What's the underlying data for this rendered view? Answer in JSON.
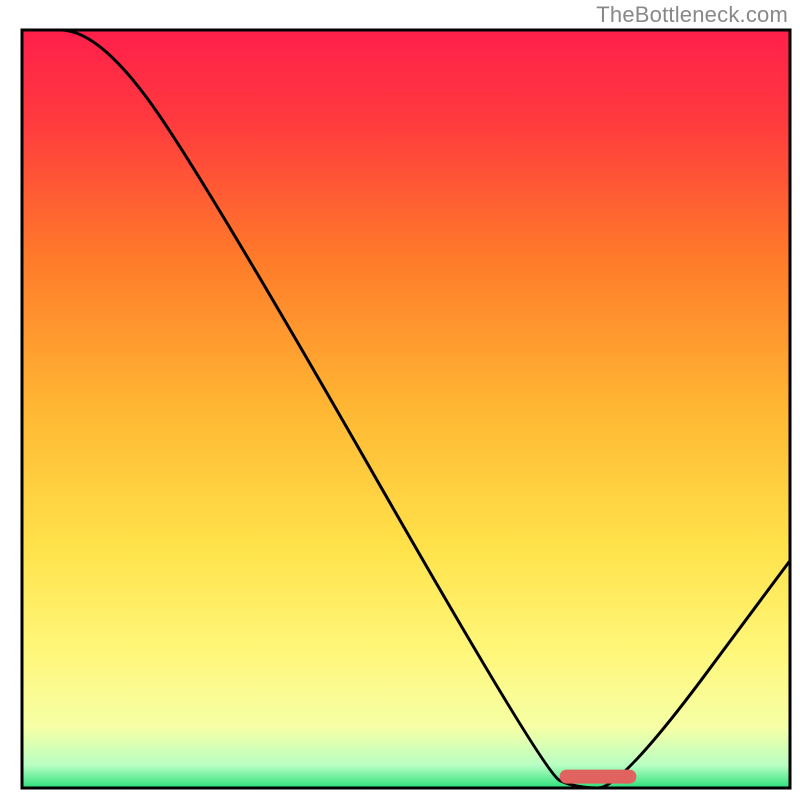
{
  "attribution": "TheBottleneck.com",
  "chart_data": {
    "type": "line",
    "title": "",
    "xlabel": "",
    "ylabel": "",
    "xlim": [
      0,
      100
    ],
    "ylim": [
      0,
      100
    ],
    "x": [
      0,
      10,
      24,
      68,
      72,
      78,
      100
    ],
    "values": [
      100,
      100,
      80,
      2,
      0,
      0,
      30
    ],
    "optimum_band": {
      "x_start": 70,
      "x_end": 80,
      "y": 1.5
    },
    "gradient_stops": [
      {
        "pct": 0,
        "color": "#ff1f4b"
      },
      {
        "pct": 12,
        "color": "#ff3a3e"
      },
      {
        "pct": 30,
        "color": "#ff7a2a"
      },
      {
        "pct": 50,
        "color": "#ffb733"
      },
      {
        "pct": 68,
        "color": "#ffe24a"
      },
      {
        "pct": 82,
        "color": "#fff77a"
      },
      {
        "pct": 92,
        "color": "#f6ffa6"
      },
      {
        "pct": 97,
        "color": "#b8ffc3"
      },
      {
        "pct": 100,
        "color": "#2de07a"
      }
    ],
    "border_color": "#000000"
  }
}
